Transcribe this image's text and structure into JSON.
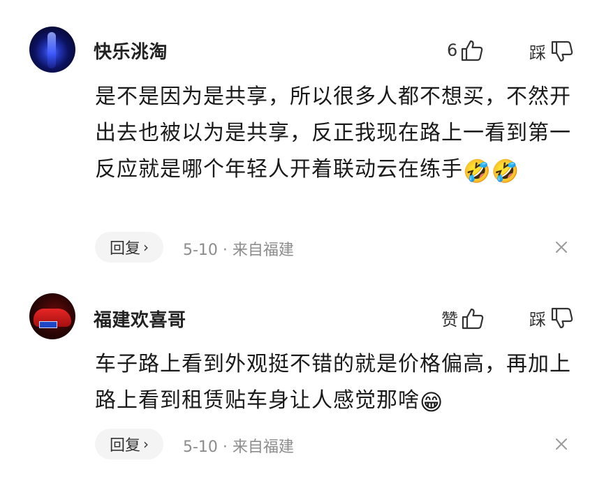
{
  "comments": [
    {
      "username": "快乐洮淘",
      "like_count": "6",
      "dislike_label": "踩",
      "text": "是不是因为是共享，所以很多人都不想买，不然开出去也被以为是共享，反正我现在路上一看到第一反应就是哪个年轻人开着联动云在练手",
      "emojis": [
        "🤣",
        "🤣"
      ],
      "reply_label": "回复",
      "meta": "5-10 · 来自福建"
    },
    {
      "username": "福建欢喜哥",
      "like_label": "赞",
      "dislike_label": "踩",
      "text": "车子路上看到外观挺不错的就是价格偏高，再加上路上看到租赁贴车身让人感觉那啥",
      "emojis": [
        "😁"
      ],
      "reply_label": "回复",
      "meta": "5-10 · 来自福建"
    }
  ],
  "icons": {
    "like": "thumbs-up-outline-icon",
    "dislike": "thumbs-down-outline-icon",
    "reply_chevron": "chevron-right-icon",
    "dismiss": "close-icon"
  },
  "colors": {
    "text": "#1a1a1a",
    "meta": "#8c8c8c",
    "reply_bg": "#f4f4f4"
  }
}
